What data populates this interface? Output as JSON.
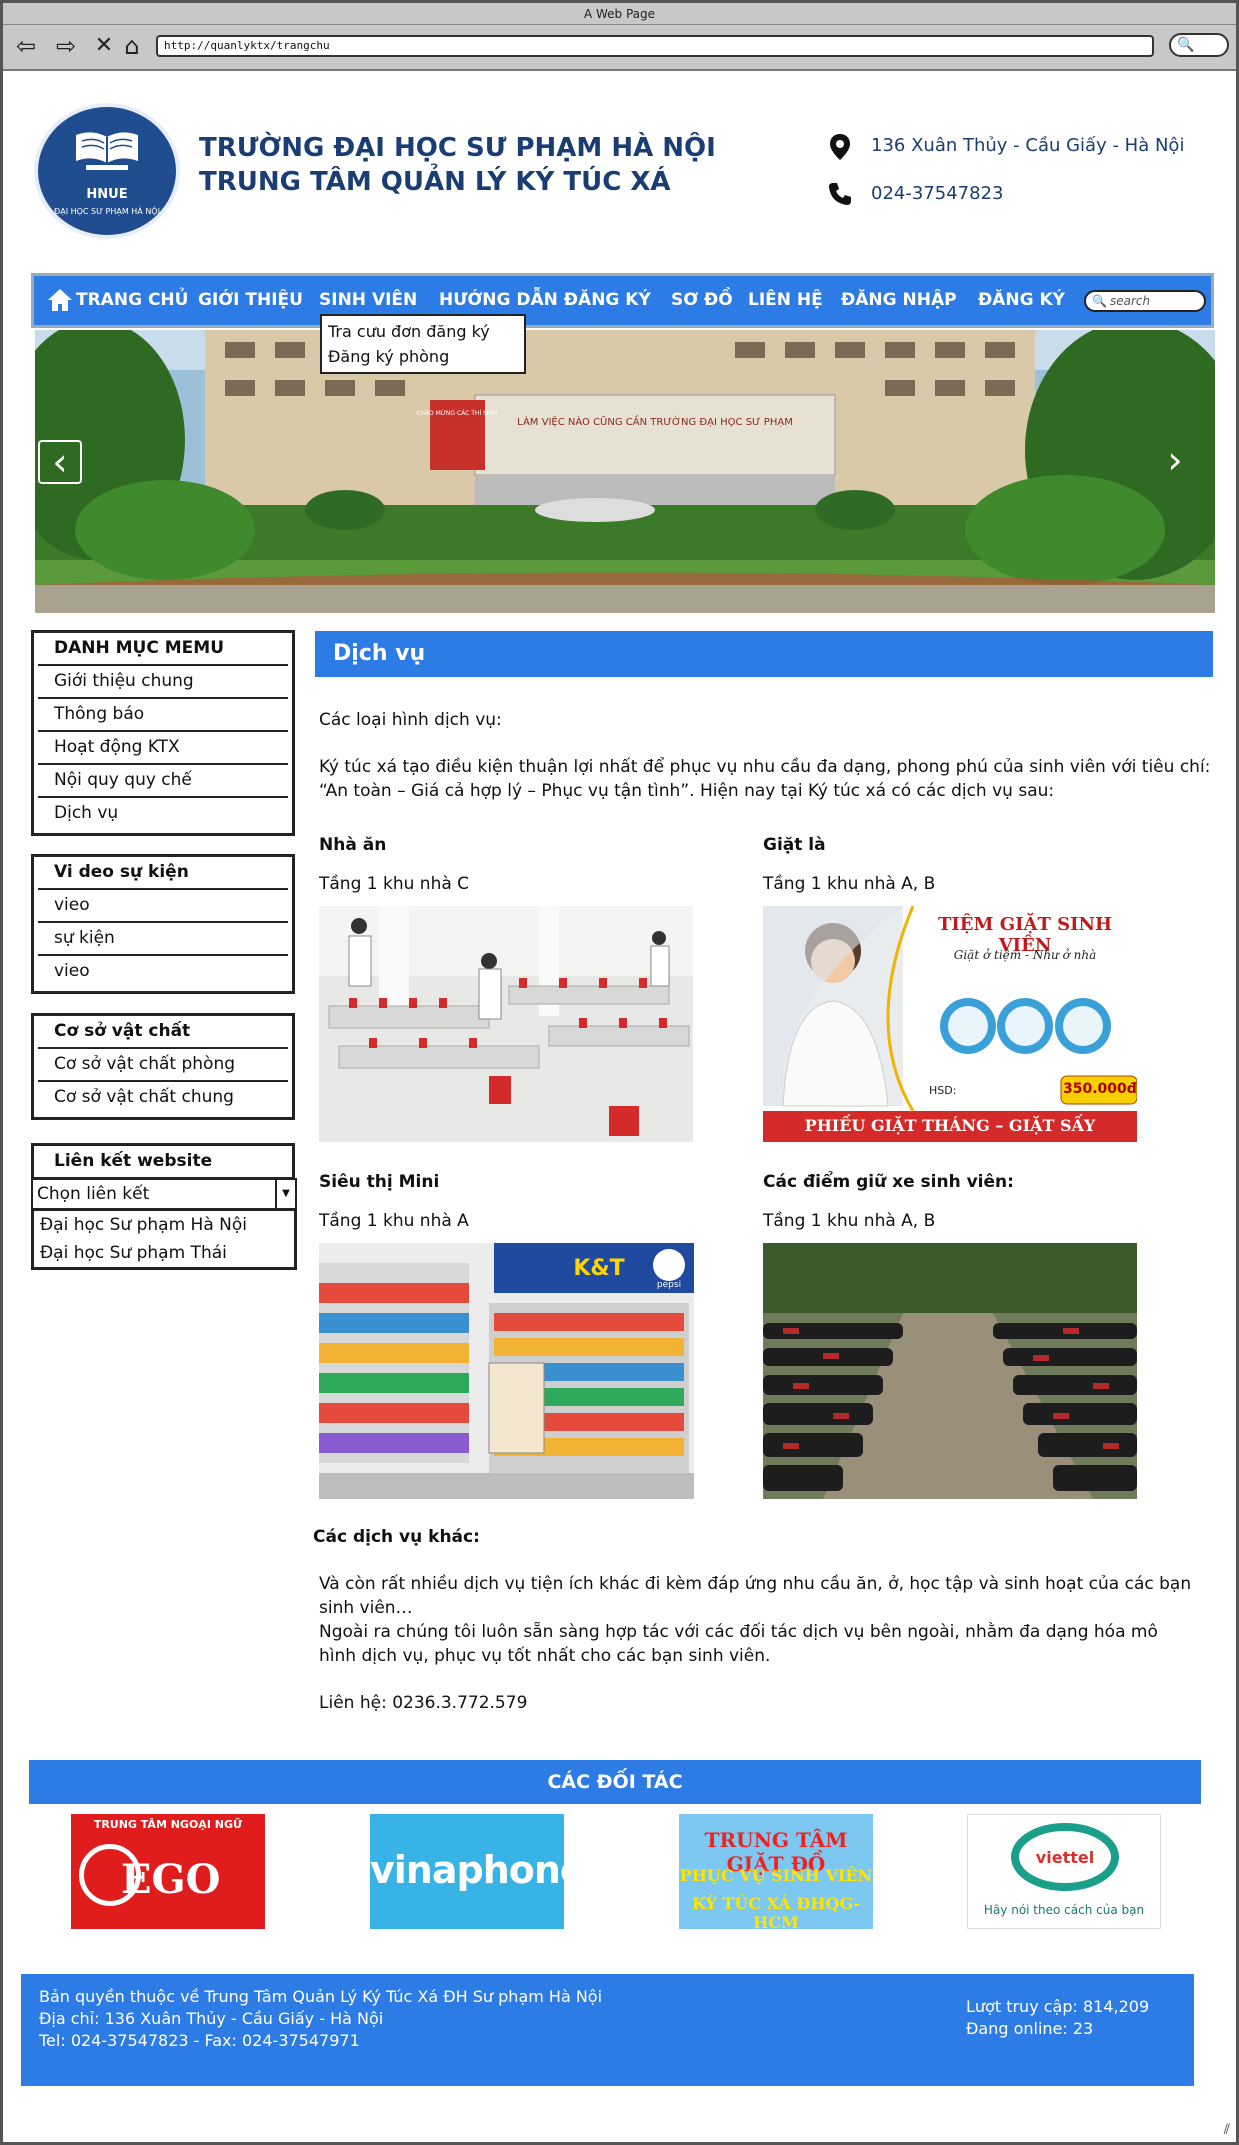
{
  "browser": {
    "window_title": "A Web Page",
    "url": "http://quanlyktx/trangchu"
  },
  "header": {
    "school_line1": "TRƯỜNG ĐẠI HỌC SƯ PHẠM HÀ NỘI",
    "school_line2": "TRUNG TÂM QUẢN LÝ KÝ TÚC XÁ",
    "logo_text": "HNUE",
    "logo_subtext": "ĐẠI HỌC SƯ PHẠM HÀ NỘI",
    "address": "136 Xuân Thủy - Cầu Giấy - Hà Nội",
    "phone": "024-37547823"
  },
  "menu": {
    "items": [
      "TRANG CHỦ",
      "GIỚI THIỆU",
      "SINH VIÊN",
      "HƯỚNG DẪN ĐĂNG KÝ",
      "SƠ ĐỒ",
      "LIÊN HỆ",
      "ĐĂNG NHẬP",
      "ĐĂNG KÝ"
    ],
    "search_placeholder": "search",
    "dropdown": [
      "Tra cưu đơn đăng ký",
      "Đăng ký phòng"
    ]
  },
  "banner": {
    "sign_text": "CHÀO MỪNG CÁC THÍ SINH",
    "building_text": "LÀM VIỆC NÀO CŨNG CẦN TRƯỜNG ĐẠI HỌC SƯ PHẠM"
  },
  "sidebar": {
    "menu": [
      "DANH MỤC MEMU",
      "Giới thiệu chung",
      "Thông báo",
      "Hoạt động KTX",
      "Nội quy quy chế",
      "Dịch vụ"
    ],
    "video": [
      "Vi deo sự kiện",
      "vieo",
      "sự kiện",
      "vieo"
    ],
    "facility": [
      "Cơ sở vật chất",
      "Cơ sở vật chất phòng",
      "Cơ sở vật chất chung"
    ],
    "links_title": "Liên kết website",
    "links_select": "Chọn liên kết",
    "links": [
      "Đại học Sư phạm Hà Nội",
      "Đại học Sư phạm Thái"
    ]
  },
  "main": {
    "title": "Dịch vụ",
    "intro": "Các loại hình dịch vụ:",
    "desc": "Ký túc xá tạo điều kiện thuận lợi nhất để phục vụ nhu cầu đa dạng, phong phú của sinh viên với tiêu chí: “An toàn – Giá cả hợp lý – Phục vụ tận tình”. Hiện nay tại Ký túc xá có các dịch vụ sau:",
    "services": [
      {
        "name": "Nhà ăn",
        "location": "Tầng 1 khu nhà C"
      },
      {
        "name": "Giặt là",
        "location": "Tầng 1 khu nhà A, B"
      },
      {
        "name": "Siêu thị Mini",
        "location": "Tầng 1 khu nhà A"
      },
      {
        "name": "Các điểm giữ xe sinh viên:",
        "location": "Tầng 1 khu nhà A, B"
      }
    ],
    "laundry_ad": {
      "title": "TIỆM GIẶT SINH VIÊN",
      "slogan": "Giặt ở tiệm - Như ở nhà",
      "price": "350.000đ",
      "hsd": "HSD:",
      "footer": "PHIẾU GIẶT THÁNG – GIẶT SẤY"
    },
    "mart_sign": "K&T",
    "mart_brand": "pepsi",
    "other_title": "Các dịch vụ khác:",
    "other_p1": "Và còn rất nhiều dịch vụ tiện ích khác đi kèm đáp ứng nhu cầu ăn, ở, học tập và sinh hoạt của các bạn sinh viên…",
    "other_p2": "Ngoài ra chúng tôi luôn sẵn sàng hợp tác với các đối tác dịch vụ bên ngoài, nhằm đa dạng hóa mô hình dịch vụ, phục vụ tốt nhất cho các bạn sinh viên.",
    "contact": "Liên hệ: 0236.3.772.579"
  },
  "partners": {
    "title": "CÁC ĐỐI TÁC",
    "ego_top": "TRUNG TÂM NGOẠI NGỮ",
    "ego_name": "EGO",
    "vinaphone": "vinaphone",
    "laundry_line1": "TRUNG TÂM GIẶT ĐỒ",
    "laundry_line2": "PHỤC VỤ SINH VIÊN",
    "laundry_line3": "KÝ TÚC XÁ ĐHQG-HCM",
    "viettel_name": "viettel",
    "viettel_slogan": "Hãy nói theo cách của bạn"
  },
  "footer": {
    "line1": "Bản quyền thuộc về Trung Tâm Quản Lý Ký Túc Xá ĐH Sư phạm Hà Nội",
    "line2": "Địa chỉ: 136 Xuân Thủy - Cầu Giấy - Hà Nội",
    "line3": "Tel: 024-37547823 - Fax: 024-37547971",
    "visits": "Lượt truy cập: 814,209",
    "online": "Đang online: 23"
  },
  "colors": {
    "accent": "#2d7be5",
    "navy": "#1a3e73"
  }
}
